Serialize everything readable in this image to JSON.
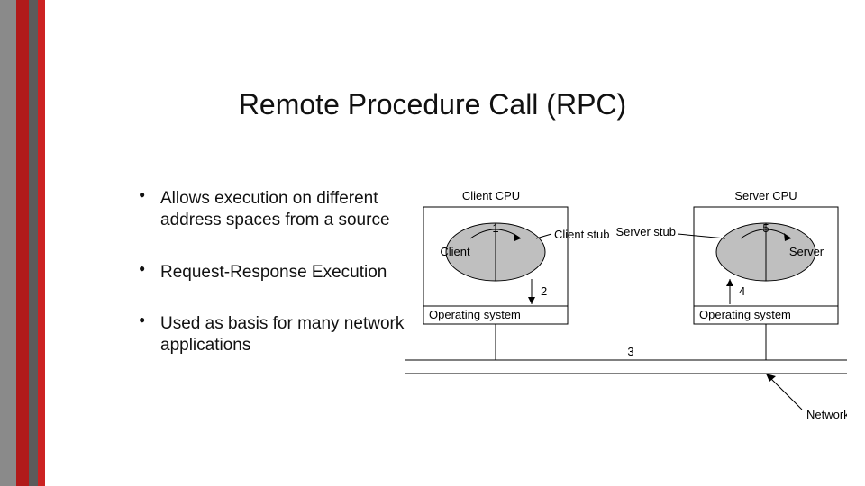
{
  "title": "Remote Procedure Call (RPC)",
  "bullets": [
    "Allows execution on different address spaces from a source",
    "Request-Response Execution",
    "Used as basis for many network applications"
  ],
  "diagram": {
    "client_cpu": "Client CPU",
    "server_cpu": "Server CPU",
    "client": "Client",
    "client_stub": "Client stub",
    "server": "Server",
    "server_stub": "Server stub",
    "os_left": "Operating system",
    "os_right": "Operating system",
    "network": "Network",
    "step1": "1",
    "step2": "2",
    "step3": "3",
    "step4": "4",
    "step5": "5"
  }
}
